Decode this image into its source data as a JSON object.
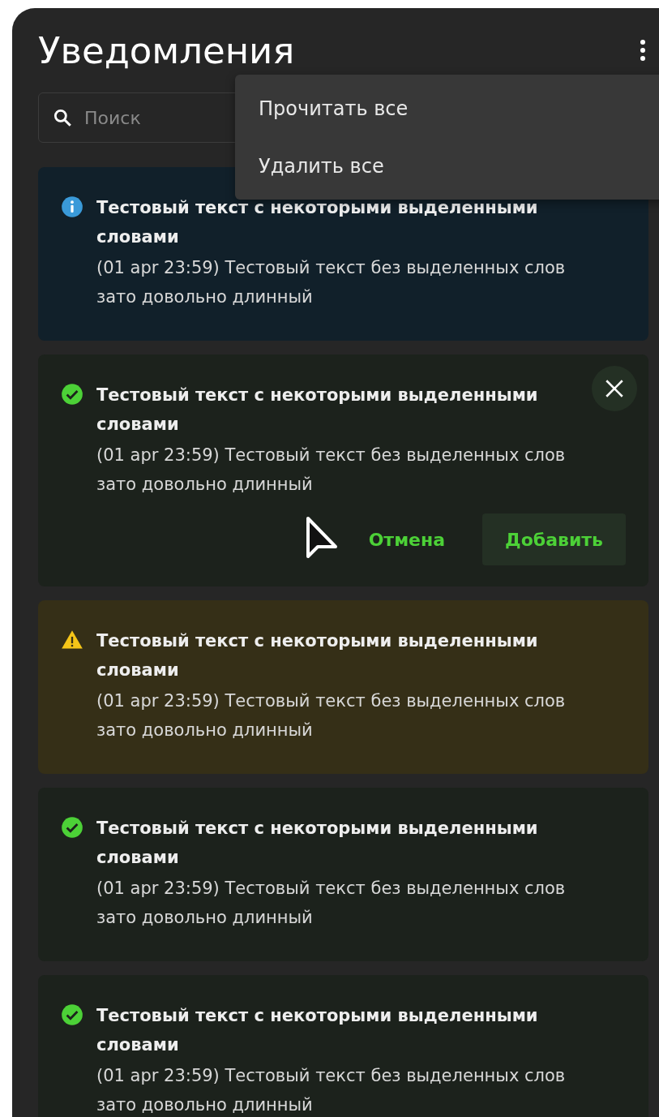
{
  "title": "Уведомления",
  "search": {
    "placeholder": "Поиск"
  },
  "menu": {
    "items": [
      "Прочитать все",
      "Удалить все"
    ]
  },
  "notifications": [
    {
      "kind": "info",
      "title": "Тестовый текст с некоторыми выделенными словами",
      "body": "(01 apr 23:59) Тестовый текст без выделенных  слов зато довольно длинный",
      "dismissible": false
    },
    {
      "kind": "success",
      "title": "Тестовый текст с некоторыми выделенными словами",
      "body": "(01 apr 23:59) Тестовый текст без выделенных  слов зато довольно длинный",
      "dismissible": true,
      "actions": [
        {
          "label": "Отмена",
          "kind": "text"
        },
        {
          "label": "Добавить",
          "kind": "filled"
        }
      ]
    },
    {
      "kind": "warning",
      "title": "Тестовый текст с некоторыми выделенными словами",
      "body": "(01 apr 23:59) Тестовый текст без выделенных  слов зато довольно длинный",
      "dismissible": false
    },
    {
      "kind": "success",
      "title": "Тестовый текст с некоторыми выделенными словами",
      "body": "(01 apr 23:59) Тестовый текст без выделенных  слов зато довольно длинный",
      "dismissible": false
    },
    {
      "kind": "success",
      "title": "Тестовый текст с некоторыми выделенными словами",
      "body": "(01 apr 23:59) Тестовый текст без выделенных  слов зато довольно длинный",
      "dismissible": false
    }
  ]
}
